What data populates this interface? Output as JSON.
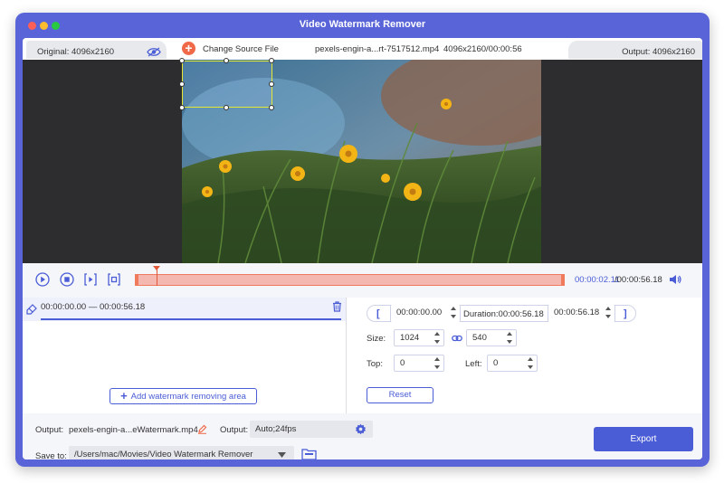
{
  "window": {
    "title": "Video Watermark Remover"
  },
  "header": {
    "original_label": "Original: 4096x2160",
    "change_source": "Change Source File",
    "file_name": "pexels-engin-a...rt-7517512.mp4",
    "file_info": "4096x2160/00:00:56",
    "output_label": "Output: 4096x2160"
  },
  "timeline": {
    "current_time": "00:00:02.11",
    "total_time": "/00:00:56.18"
  },
  "segment": {
    "range_text": "00:00:00.00 — 00:00:56.18"
  },
  "left_panel": {
    "add_area_label": "Add watermark removing area"
  },
  "right_panel": {
    "start_time": "00:00:00.00",
    "duration_label": "Duration:00:00:56.18",
    "end_time": "00:00:56.18",
    "size_label": "Size:",
    "width_value": "1024",
    "height_value": "540",
    "top_label": "Top:",
    "top_value": "0",
    "left_label": "Left:",
    "left_value": "0",
    "reset_label": "Reset"
  },
  "bottom": {
    "output_label": "Output:",
    "output_file": "pexels-engin-a...eWatermark.mp4",
    "output_format_label": "Output:",
    "output_format": "Auto;24fps",
    "save_to_label": "Save to:",
    "save_path": "/Users/mac/Movies/Video Watermark Remover",
    "export_label": "Export"
  },
  "colors": {
    "window_frame": "#5864d8",
    "accent": "#4a5cd6",
    "track_fill": "#f4b8b0",
    "track_border": "#ef7a62",
    "add_source": "#f06a4a"
  }
}
